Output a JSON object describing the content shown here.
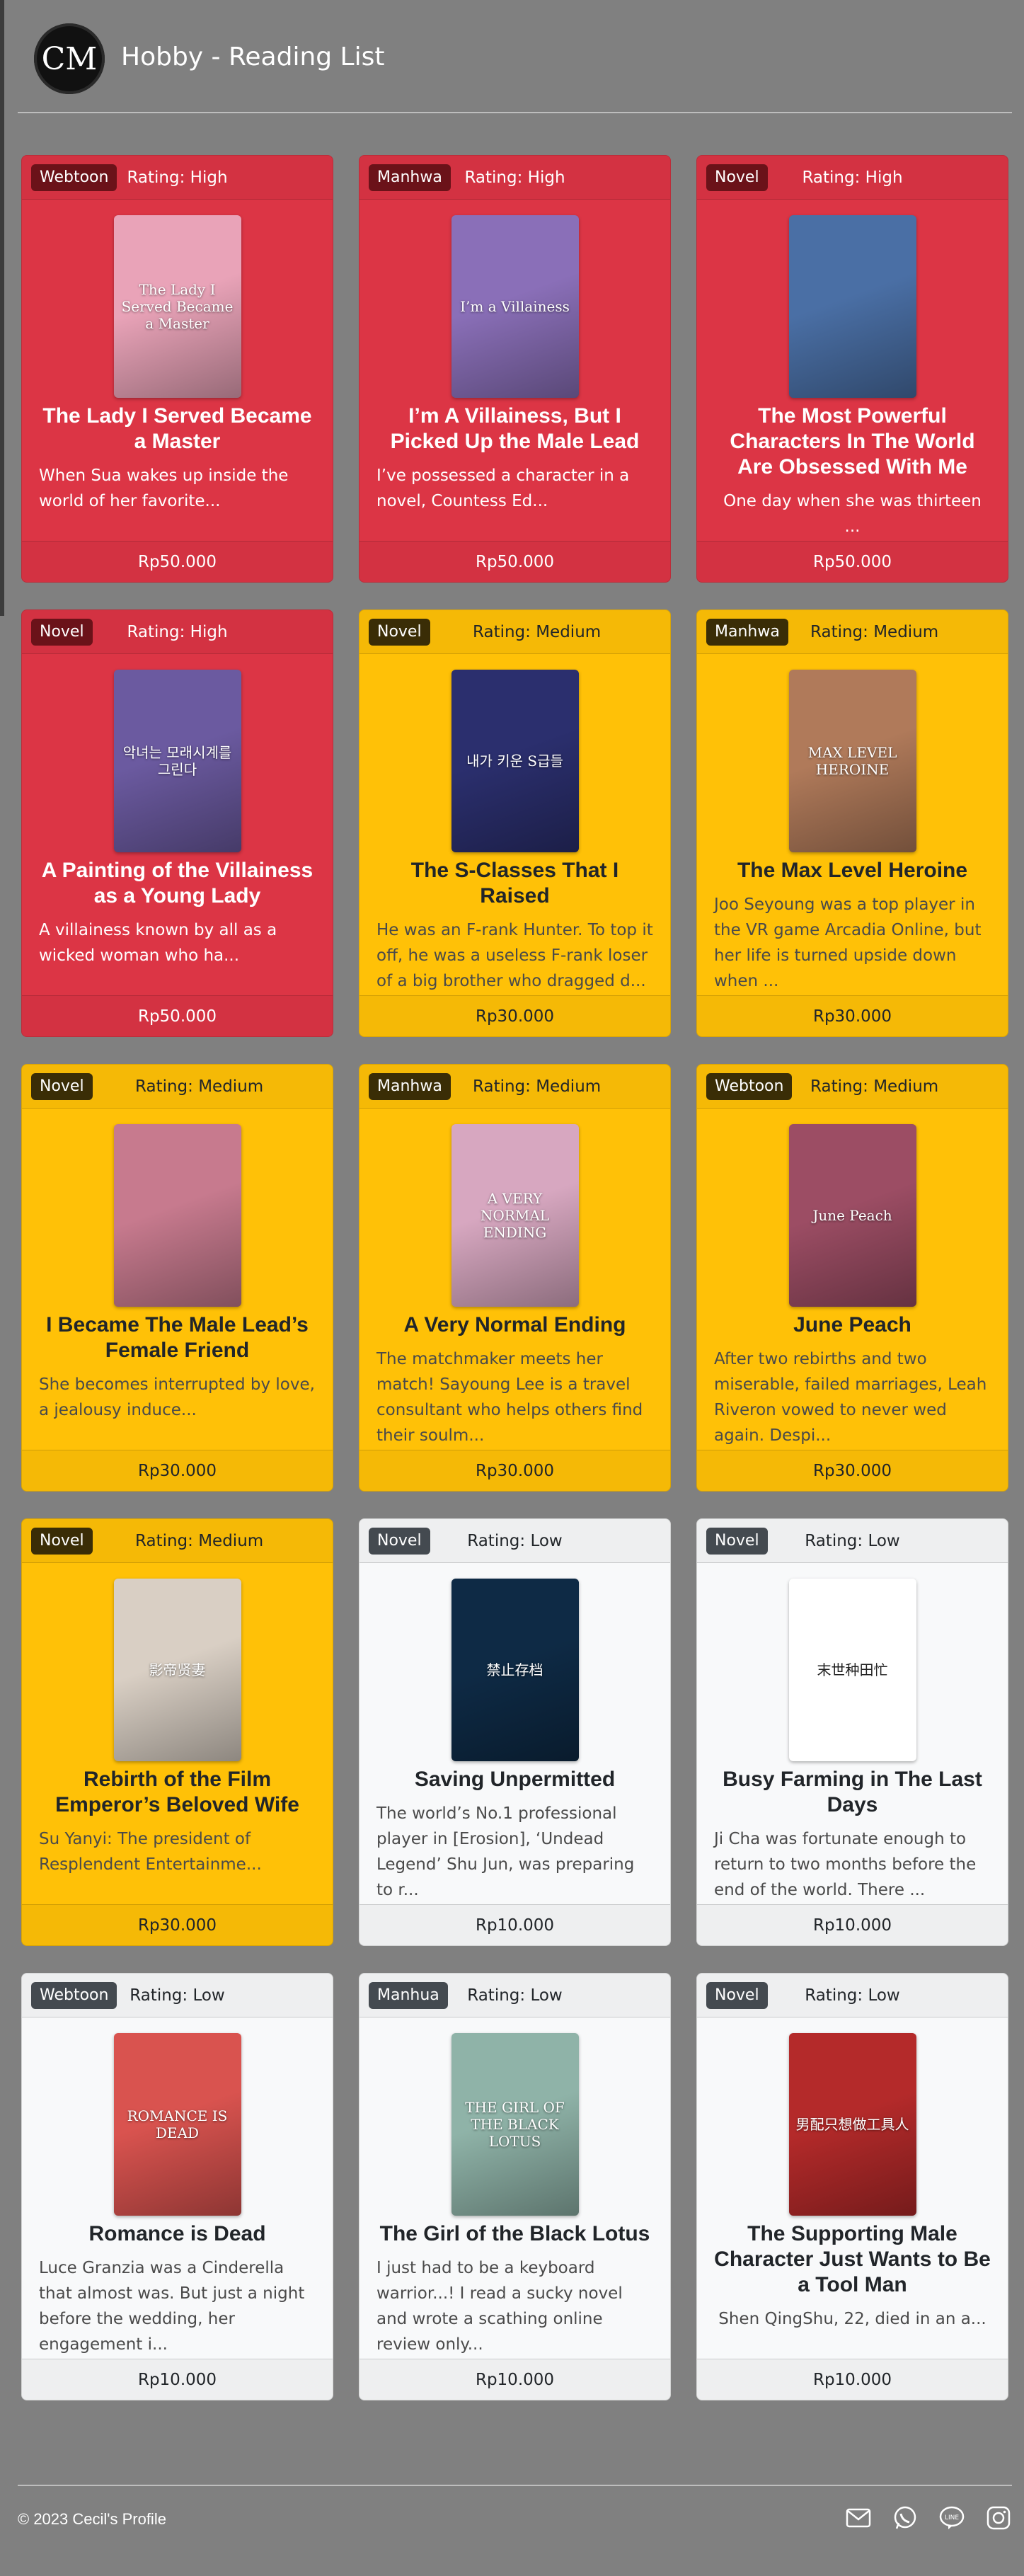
{
  "site": {
    "logo_text": "CM",
    "title": "Hobby - Reading List"
  },
  "cards": [
    {
      "type": "Webtoon",
      "rating": "Rating: High",
      "level": "high",
      "title": "The Lady I Served Became a Master",
      "text": "When Sua wakes up inside the world of her favorite...",
      "price": "Rp50.000",
      "cover_text": "The Lady I Served Became a Master",
      "cover_color": "#e9a3b8"
    },
    {
      "type": "Manhwa",
      "rating": "Rating: High",
      "level": "high",
      "title": "I’m A Villainess, But I Picked Up the Male Lead",
      "text": "I’ve possessed a character in a novel, Countess Ed...",
      "price": "Rp50.000",
      "cover_text": "I’m a Villainess",
      "cover_color": "#8a6fb8"
    },
    {
      "type": "Novel",
      "rating": "Rating: High",
      "level": "high",
      "title": "The Most Powerful Characters In The World Are Obsessed With Me",
      "text": "One day when she was thirteen ...",
      "price": "Rp50.000",
      "cover_text": "",
      "cover_color": "#4a6fa5"
    },
    {
      "type": "Novel",
      "rating": "Rating: High",
      "level": "high",
      "title": "A Painting of the Villainess as a Young Lady",
      "text": "A villainess known by all as a wicked woman who ha...",
      "price": "Rp50.000",
      "cover_text": "악녀는 모래시계를 그린다",
      "cover_color": "#6b5aa0"
    },
    {
      "type": "Novel",
      "rating": "Rating: Medium",
      "level": "medium",
      "title": "The S-Classes That I Raised",
      "text": "He was an F-rank Hunter. To top it off, he was a useless F-rank loser of a big brother who dragged d...",
      "price": "Rp30.000",
      "cover_text": "내가 키운 S급들",
      "cover_color": "#2b2f6e"
    },
    {
      "type": "Manhwa",
      "rating": "Rating: Medium",
      "level": "medium",
      "title": "The Max Level Heroine",
      "text": "Joo Seyoung was a top player in the VR game Arcadia Online, but her life is turned upside down when ...",
      "price": "Rp30.000",
      "cover_text": "MAX LEVEL HEROINE",
      "cover_color": "#b07a5a"
    },
    {
      "type": "Novel",
      "rating": "Rating: Medium",
      "level": "medium",
      "title": "I Became The Male Lead’s Female Friend",
      "text": "She becomes interrupted by love, a jealousy induce...",
      "price": "Rp30.000",
      "cover_text": "",
      "cover_color": "#c77a8e"
    },
    {
      "type": "Manhwa",
      "rating": "Rating: Medium",
      "level": "medium",
      "title": "A Very Normal Ending",
      "text": "The matchmaker meets her match! Sayoung Lee is a travel consultant who helps others find their soulm...",
      "price": "Rp30.000",
      "cover_text": "A VERY NORMAL ENDING",
      "cover_color": "#d7a7c0"
    },
    {
      "type": "Webtoon",
      "rating": "Rating: Medium",
      "level": "medium",
      "title": "June Peach",
      "text": "After two rebirths and two miserable, failed marriages, Leah Riveron vowed to never wed again. Despi...",
      "price": "Rp30.000",
      "cover_text": "June Peach",
      "cover_color": "#9c4d64"
    },
    {
      "type": "Novel",
      "rating": "Rating: Medium",
      "level": "medium",
      "title": "Rebirth of the Film Emperor’s Beloved Wife",
      "text": "Su Yanyi: The president of Resplendent Entertainme...",
      "price": "Rp30.000",
      "cover_text": "影帝贤妻",
      "cover_color": "#d9cfc4"
    },
    {
      "type": "Novel",
      "rating": "Rating: Low",
      "level": "low",
      "title": "Saving Unpermitted",
      "text": "The world’s No.1 professional player in [Erosion], ‘Undead Legend’ Shu Jun, was preparing to r...",
      "price": "Rp10.000",
      "cover_text": "禁止存档",
      "cover_color": "#0e2a45"
    },
    {
      "type": "Novel",
      "rating": "Rating: Low",
      "level": "low",
      "title": "Busy Farming in The Last Days",
      "text": "Ji Cha was fortunate enough to return to two months before the end of the world. There ...",
      "price": "Rp10.000",
      "cover_text": "末世种田忙",
      "cover_color": "#ffffff"
    },
    {
      "type": "Webtoon",
      "rating": "Rating: Low",
      "level": "low",
      "title": "Romance is Dead",
      "text": "Luce Granzia was a Cinderella that almost was. But just a night before the wedding, her engagement i...",
      "price": "Rp10.000",
      "cover_text": "ROMANCE IS DEAD",
      "cover_color": "#d9534f"
    },
    {
      "type": "Manhua",
      "rating": "Rating: Low",
      "level": "low",
      "title": "The Girl of the Black Lotus",
      "text": "I just had to be a keyboard warrior...! I read a sucky novel and wrote a scathing online review only...",
      "price": "Rp10.000",
      "cover_text": "THE GIRL OF THE BLACK LOTUS",
      "cover_color": "#8fb3a8"
    },
    {
      "type": "Novel",
      "rating": "Rating: Low",
      "level": "low",
      "title": "The Supporting Male Character Just Wants to Be a Tool Man",
      "text": "Shen QingShu, 22, died in an a...",
      "price": "Rp10.000",
      "cover_text": "男配只想做工具人",
      "cover_color": "#b42a2a"
    }
  ],
  "footer": {
    "copyright": "© 2023 Cecil's Profile",
    "icons": [
      "mail-icon",
      "whatsapp-icon",
      "line-icon",
      "instagram-icon"
    ]
  }
}
